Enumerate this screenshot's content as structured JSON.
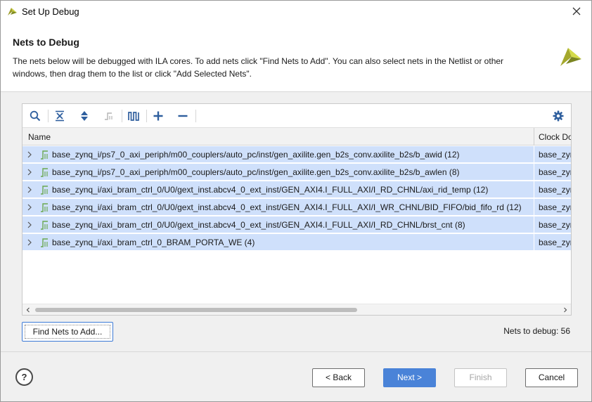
{
  "window": {
    "title": "Set Up Debug"
  },
  "header": {
    "title": "Nets to Debug",
    "description": "The nets below will be debugged with ILA cores. To add nets click \"Find Nets to Add\". You can also select nets in the Netlist or other windows, then drag them to the list or click \"Add Selected Nets\"."
  },
  "toolbar": {
    "icons": [
      "search-icon",
      "collapse-all-icon",
      "expand-all-icon",
      "net-filter-icon",
      "waveform-icon",
      "add-icon",
      "remove-icon",
      "settings-icon"
    ]
  },
  "table": {
    "columns": {
      "name": "Name",
      "clock": "Clock Domain"
    },
    "rows": [
      {
        "name": "base_zynq_i/ps7_0_axi_periph/m00_couplers/auto_pc/inst/gen_axilite.gen_b2s_conv.axilite_b2s/b_awid (12)",
        "clock": "base_zynq"
      },
      {
        "name": "base_zynq_i/ps7_0_axi_periph/m00_couplers/auto_pc/inst/gen_axilite.gen_b2s_conv.axilite_b2s/b_awlen (8)",
        "clock": "base_zynq"
      },
      {
        "name": "base_zynq_i/axi_bram_ctrl_0/U0/gext_inst.abcv4_0_ext_inst/GEN_AXI4.I_FULL_AXI/I_RD_CHNL/axi_rid_temp (12)",
        "clock": "base_zynq"
      },
      {
        "name": "base_zynq_i/axi_bram_ctrl_0/U0/gext_inst.abcv4_0_ext_inst/GEN_AXI4.I_FULL_AXI/I_WR_CHNL/BID_FIFO/bid_fifo_rd (12)",
        "clock": "base_zynq"
      },
      {
        "name": "base_zynq_i/axi_bram_ctrl_0/U0/gext_inst.abcv4_0_ext_inst/GEN_AXI4.I_FULL_AXI/I_RD_CHNL/brst_cnt (8)",
        "clock": "base_zynq"
      },
      {
        "name": "base_zynq_i/axi_bram_ctrl_0_BRAM_PORTA_WE (4)",
        "clock": "base_zynq"
      }
    ]
  },
  "actions": {
    "find_nets": "Find Nets to Add...",
    "nets_count": "Nets to debug: 56"
  },
  "footer": {
    "help": "?",
    "back": "< Back",
    "next": "Next >",
    "finish": "Finish",
    "cancel": "Cancel"
  },
  "colors": {
    "selection": "#cfe0fb",
    "primary": "#4a83d8",
    "signal_icon": "#6aa84f"
  }
}
